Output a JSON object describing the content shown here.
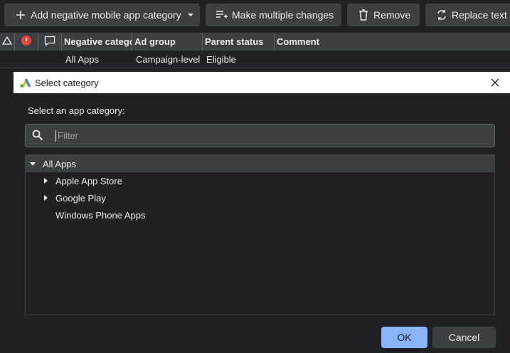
{
  "toolbar": {
    "add_label": "Add negative mobile app category",
    "multi_label": "Make multiple changes",
    "remove_label": "Remove",
    "replace_label": "Replace text"
  },
  "grid": {
    "columns": [
      "Negative catego...",
      "Ad group",
      "Parent status",
      "Comment"
    ],
    "row": {
      "category": "All Apps",
      "ad_group": "Campaign-level",
      "parent_status": "Eligible"
    }
  },
  "modal": {
    "title": "Select category",
    "prompt": "Select an app category:",
    "filter_placeholder": "Filter",
    "tree": {
      "root": "All Apps",
      "children": [
        "Apple App Store",
        "Google Play",
        "Windows Phone Apps"
      ]
    },
    "ok_label": "OK",
    "cancel_label": "Cancel"
  },
  "colors": {
    "background": "#202124",
    "surface": "#3c4043",
    "accent": "#8ab4f8",
    "error": "#ea4335"
  }
}
